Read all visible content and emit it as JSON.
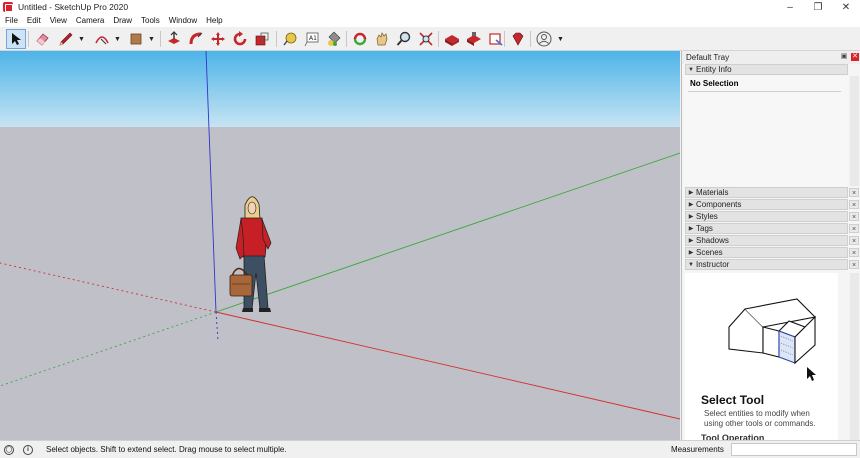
{
  "window": {
    "title": "Untitled - SketchUp Pro 2020",
    "controls": [
      "minimize",
      "restore",
      "close"
    ]
  },
  "menu": [
    "File",
    "Edit",
    "View",
    "Camera",
    "Draw",
    "Tools",
    "Window",
    "Help"
  ],
  "toolbar": {
    "tools": [
      "select-icon",
      "eraser-icon",
      "pencil-line-icon",
      "arc-icon",
      "shapes-icon",
      "push-pull-icon",
      "follow-me-icon",
      "move-icon",
      "rotate-icon",
      "scale-icon",
      "tape-measure-icon",
      "text-icon",
      "paint-bucket-icon",
      "orbit-icon",
      "pan-icon",
      "zoom-icon",
      "zoom-extents-icon",
      "warehouse-icon",
      "extension-warehouse-icon",
      "sendto-layout-icon",
      "ruby-icon",
      "account-icon"
    ]
  },
  "tray": {
    "title": "Default Tray",
    "entity_info": {
      "label": "Entity Info",
      "selection": "No Selection"
    },
    "panels": [
      "Materials",
      "Components",
      "Styles",
      "Tags",
      "Shadows",
      "Scenes",
      "Instructor"
    ],
    "instructor": {
      "title": "Select Tool",
      "description": "Select entities to modify when using other tools or commands.",
      "section": "Tool Operation"
    }
  },
  "status": {
    "message": "Select objects. Shift to extend select. Drag mouse to select multiple.",
    "measurements_label": "Measurements",
    "measurements_value": ""
  },
  "colors": {
    "sky_top": "#4db4e8",
    "sky_bottom": "#c7e4f3",
    "ground": "#c0c0c8",
    "axis_red": "#d22f2f",
    "axis_green": "#3aa83a",
    "axis_blue": "#3333cc",
    "close_red": "#d8232a"
  }
}
